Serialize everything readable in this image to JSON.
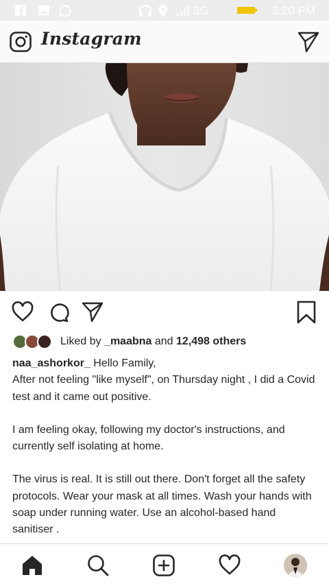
{
  "status_bar": {
    "time": "3:20 PM",
    "network": "3G",
    "icons": [
      "facebook-icon",
      "gallery-icon",
      "whatsapp-icon",
      "headphones-icon",
      "location-icon",
      "signal-icon",
      "battery-icon"
    ]
  },
  "header": {
    "logo": "Instagram",
    "left_icon": "camera-icon",
    "right_icon": "direct-message-icon"
  },
  "post": {
    "actions": [
      "like-icon",
      "comment-icon",
      "share-icon",
      "save-icon"
    ],
    "likes": {
      "prefix": "Liked by ",
      "user": "_maabna",
      "middle": " and ",
      "others": "12,498 others"
    },
    "caption": {
      "username": "naa_ashorkor_",
      "paragraph1_first": "Hello Family,",
      "paragraph1_rest": "After not feeling \"like myself\", on Thursday night , I did a Covid test and it came out positive.",
      "paragraph2": "I am feeling okay, following my doctor's instructions, and currently self isolating at home.",
      "paragraph3": "The virus is real. It is still out there. Don't forget all the safety protocols. Wear your mask at all times. Wash your hands with soap under running water. Use an alcohol-based hand sanitiser ."
    }
  },
  "bottom_nav": {
    "items": [
      "home-icon",
      "search-icon",
      "new-post-icon",
      "activity-icon",
      "profile-avatar"
    ],
    "active": "home"
  },
  "colors": {
    "text": "#262626",
    "border": "#dbdbdb",
    "status_bar": "#ededed",
    "battery": "#f0c400"
  }
}
